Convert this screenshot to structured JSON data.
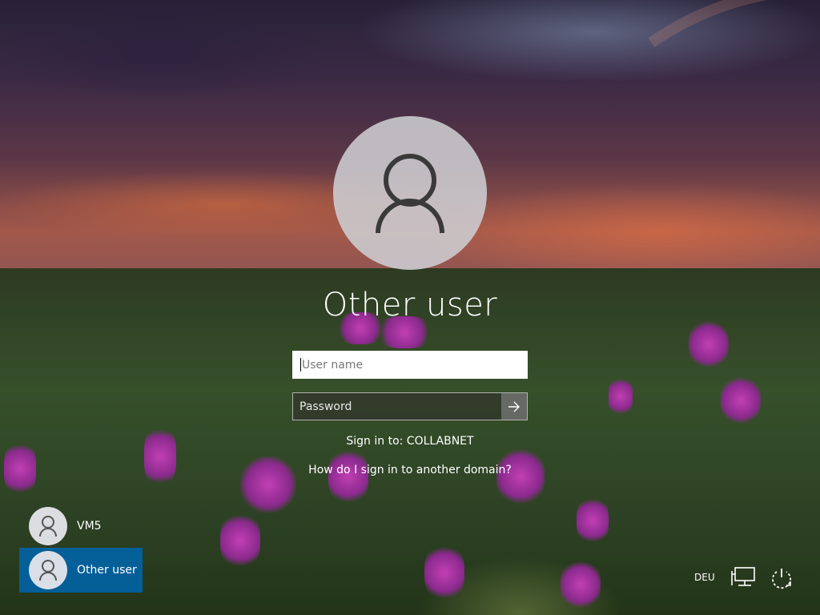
{
  "login": {
    "user_title": "Other user",
    "username_placeholder": "User name",
    "password_placeholder": "Password",
    "sign_in_to": "Sign in to: COLLABNET",
    "domain_help_link": "How do I sign in to another domain?"
  },
  "users": [
    {
      "name": "VM5",
      "selected": false
    },
    {
      "name": "Other user",
      "selected": true
    }
  ],
  "tray": {
    "language": "DEU",
    "network_icon": "network-icon",
    "power_icon": "power-icon"
  },
  "colors": {
    "selected_user_bg": "#0064aa",
    "avatar_bg": "#cdcdd2"
  }
}
